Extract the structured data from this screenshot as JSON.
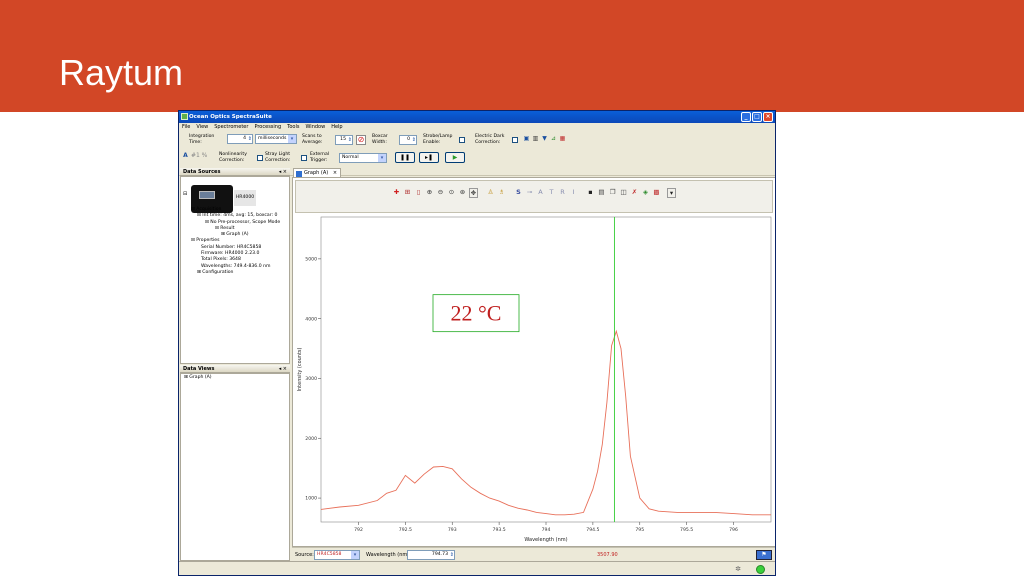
{
  "slide": {
    "title": "Raytum"
  },
  "window": {
    "title": "Ocean Optics SpectraSuite"
  },
  "menu": [
    "File",
    "View",
    "Spectrometer",
    "Processing",
    "Tools",
    "Window",
    "Help"
  ],
  "toolbar": {
    "integration_time_label": "Integration Time:",
    "integration_time_value": "4",
    "integration_unit": "milliseconds",
    "scans_label": "Scans to Average:",
    "scans_value": "15",
    "boxcar_label": "Boxcar Width:",
    "boxcar_value": "0",
    "strobe_label": "Strobe/Lamp Enable:",
    "dark_label": "Electric Dark Correction:",
    "nonlinearity_label": "Nonlinearity Correction:",
    "stray_light_label": "Stray Light Correction:",
    "ext_trigger_label": "External Trigger:",
    "trigger_mode": "Normal"
  },
  "data_sources": {
    "header": "Data Sources",
    "controls": "◂ ×",
    "device_name": "HR4000",
    "tree": [
      "⊟ Acquisition",
      "⊟ Int time: 4ms, avg: 15, boxcar: 0",
      "⊟ No Pre-processor, Scope Mode",
      "⊟ Result",
      "⊞ Graph (A)",
      "⊟ Properties",
      "Serial Number: HR4C5858",
      "Firmware: HR4000 2.23.0",
      "Total Pixels: 3648",
      "Wavelengths: 749.4-836.0 nm",
      "⊞ Configuration"
    ]
  },
  "data_views": {
    "header": "Data Views",
    "controls": "◂ ×",
    "tree": [
      "⊞ Graph (A)"
    ]
  },
  "graph_tab": {
    "label": "Graph (A)",
    "close": "×"
  },
  "chart_data": {
    "type": "line",
    "xlabel": "Wavelength (nm)",
    "ylabel": "Intensity (counts)",
    "xlim": [
      791.6,
      796.4
    ],
    "ylim": [
      600,
      5700
    ],
    "x_ticks": [
      792,
      792.5,
      793,
      793.5,
      794,
      794.5,
      795,
      795.5,
      796
    ],
    "x_tick_labels": [
      "792",
      "792.5",
      "793",
      "793.5",
      "794",
      "794.5",
      "795",
      "795.5",
      "796"
    ],
    "y_ticks": [
      1000,
      2000,
      3000,
      4000,
      5000
    ],
    "y_tick_labels": [
      "1000",
      "2000",
      "3000",
      "4000",
      "5000"
    ],
    "grid": true,
    "cursor_x": 794.73,
    "annotation": "22 °C",
    "series": [
      {
        "color": "#e8705a",
        "x": [
          791.6,
          791.8,
          792.0,
          792.2,
          792.3,
          792.4,
          792.5,
          792.6,
          792.7,
          792.8,
          792.9,
          793.0,
          793.1,
          793.2,
          793.3,
          793.4,
          793.5,
          793.6,
          793.7,
          793.8,
          793.9,
          794.0,
          794.1,
          794.2,
          794.3,
          794.4,
          794.5,
          794.55,
          794.6,
          794.65,
          794.7,
          794.75,
          794.8,
          794.85,
          794.9,
          795.0,
          795.1,
          795.2,
          795.4,
          795.6,
          795.8,
          796.0,
          796.2,
          796.4
        ],
        "y": [
          810,
          850,
          880,
          960,
          1080,
          1130,
          1380,
          1250,
          1400,
          1520,
          1530,
          1490,
          1320,
          1180,
          1080,
          1000,
          950,
          880,
          830,
          800,
          760,
          740,
          720,
          720,
          730,
          760,
          1150,
          1450,
          1900,
          2600,
          3550,
          3790,
          3500,
          2700,
          1700,
          1000,
          820,
          780,
          760,
          760,
          760,
          740,
          720,
          720
        ]
      }
    ]
  },
  "status": {
    "source_label": "Source:",
    "source_value": "HR4C5858",
    "wavelength_label": "Wavelength (nm):",
    "wavelength_value": "794.73",
    "intensity_value": "3507.90"
  }
}
